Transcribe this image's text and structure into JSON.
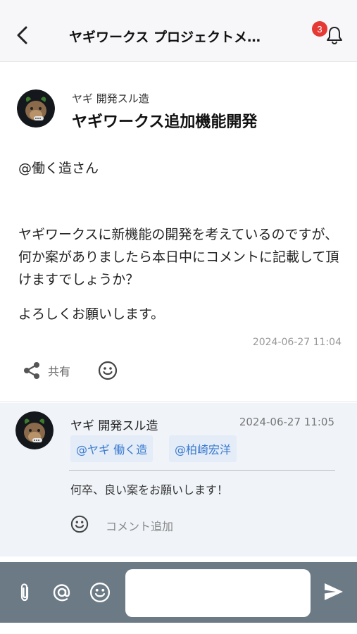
{
  "header": {
    "title": "ヤギワークス プロジェクトメ…",
    "notification_count": "3",
    "back_icon": "chevron-left-icon",
    "bell_icon": "bell-icon"
  },
  "post": {
    "author": "ヤギ 開発スル造",
    "title": "ヤギワークス追加機能開発",
    "mention": "@働く造さん",
    "body": "ヤギワークスに新機能の開発を考えているのですが、何か案がありましたら本日中にコメントに記載して頂けますでしょうか？",
    "closing": "よろしくお願いします。",
    "timestamp": "2024-06-27 11:04",
    "share_label": "共有",
    "share_icon": "share-icon",
    "reaction_icon": "smiley-icon"
  },
  "comment": {
    "author": "ヤギ 開発スル造",
    "timestamp": "2024-06-27 11:05",
    "mentions": [
      "@ヤギ 働く造",
      "@柏崎宏洋"
    ],
    "text": "何卒、良い案をお願いします！",
    "add_comment_label": "コメント追加"
  },
  "composer": {
    "attach_icon": "paperclip-icon",
    "mention_icon": "at-sign-icon",
    "emoji_icon": "smiley-icon",
    "send_icon": "send-icon",
    "input_value": ""
  },
  "colors": {
    "accent": "#3b7bd0",
    "badge": "#e53935",
    "composer_bg": "#6c7a86",
    "comment_bg": "#f0f4f9"
  }
}
